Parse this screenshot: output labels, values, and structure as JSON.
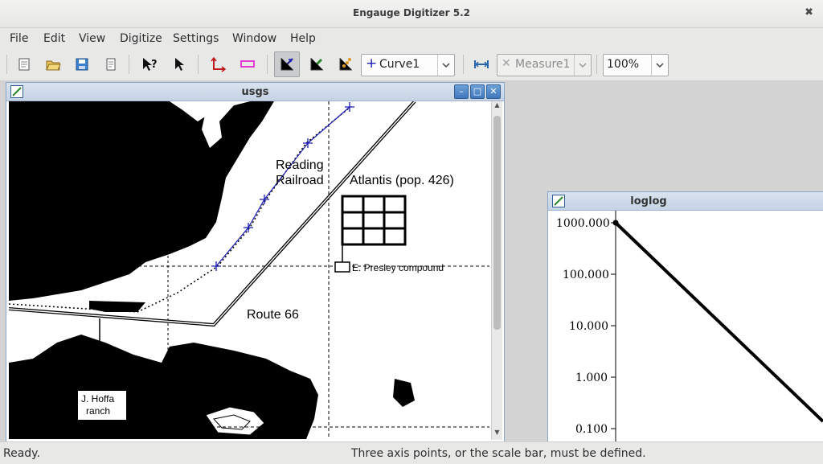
{
  "window": {
    "title": "Engauge Digitizer 5.2"
  },
  "menu": [
    "File",
    "Edit",
    "View",
    "Digitize",
    "Settings",
    "Window",
    "Help"
  ],
  "toolbar": {
    "icons": [
      "new-document-icon",
      "open-folder-icon",
      "save-icon",
      "print-icon",
      "whats-this-icon",
      "select-pointer-icon",
      "axis-point-icon",
      "scale-bar-icon",
      "curve-point-icon",
      "segment-fill-icon",
      "color-picker-icon",
      "measure-icon"
    ],
    "curve_combo": "Curve1",
    "measure_combo": "Measure1",
    "zoom_combo": "100%"
  },
  "map_window": {
    "title": "usgs",
    "labels": {
      "reading": "Reading",
      "railroad": "Railroad",
      "atlantis": "Atlantis (pop. 426)",
      "presley": "E. Presley compound",
      "route": "Route 66",
      "hoffa1": "J. Hoffa",
      "hoffa2": "ranch"
    }
  },
  "loglog_window": {
    "title": "loglog",
    "y_ticks": [
      "1000.000",
      "100.000",
      "10.000",
      "1.000",
      "0.100"
    ]
  },
  "status": {
    "left": "Ready.",
    "right": "Three axis points, or the scale bar, must be defined."
  },
  "colors": {
    "accent": "#3f78bd",
    "curve": "#1a1ab4",
    "map": "#000000"
  }
}
